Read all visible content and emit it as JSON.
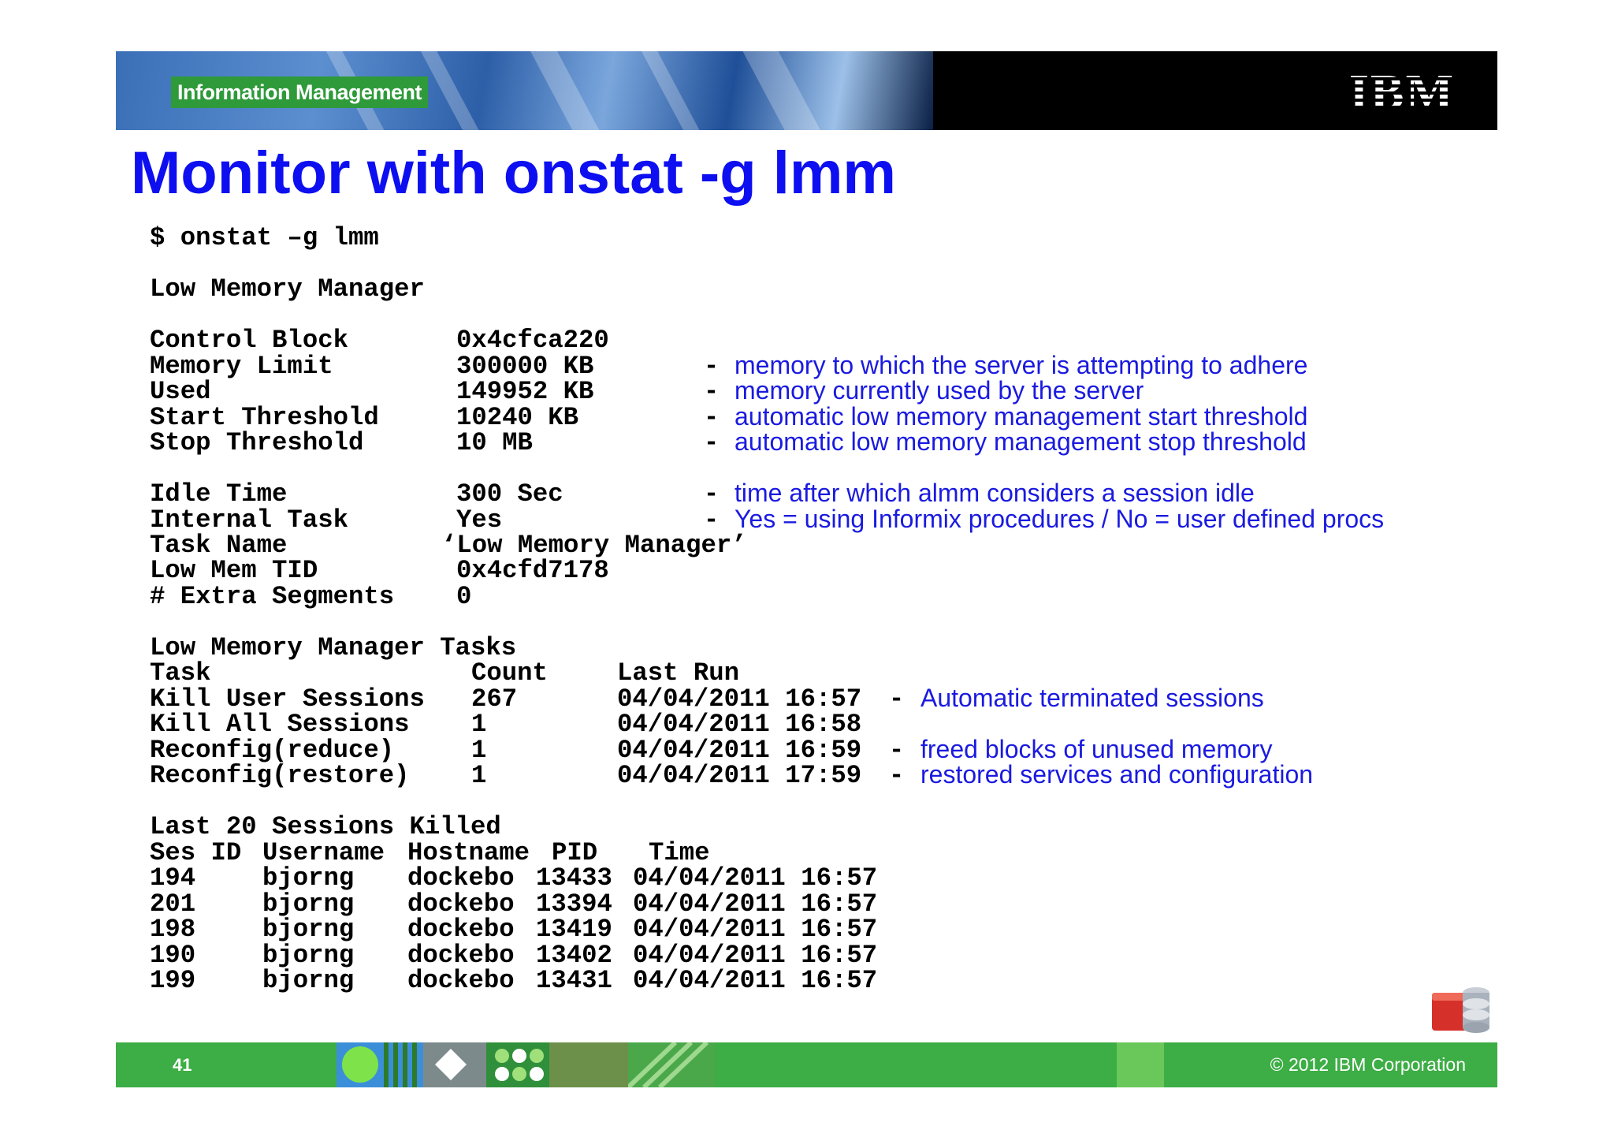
{
  "header": {
    "badge": "Information Management",
    "logo_text": "IBM"
  },
  "title": "Monitor with onstat -g lmm",
  "command": "$ onstat –g lmm",
  "section1_title": "Low Memory Manager",
  "params": [
    {
      "label": "Control Block",
      "value": "0x4cfca220",
      "note": ""
    },
    {
      "label": "Memory Limit",
      "value": "300000 KB",
      "note": "memory to which the server is attempting to adhere"
    },
    {
      "label": "Used",
      "value": "149952 KB",
      "note": "memory currently used by the server"
    },
    {
      "label": "Start Threshold",
      "value": "10240 KB",
      "note": "automatic low memory management start threshold"
    },
    {
      "label": "Stop Threshold",
      "value": "10 MB",
      "note": "automatic low memory management stop threshold"
    }
  ],
  "params2": [
    {
      "label": "Idle Time",
      "value": "300 Sec",
      "note": "time after which almm considers a session idle"
    },
    {
      "label": "Internal Task",
      "value": "Yes",
      "note": "Yes = using Informix procedures / No = user defined procs"
    },
    {
      "label": "Task Name",
      "value": "‘Low Memory Manager’",
      "note": ""
    },
    {
      "label": "Low Mem TID",
      "value": "0x4cfd7178",
      "note": ""
    },
    {
      "label": "# Extra Segments",
      "value": "0",
      "note": ""
    }
  ],
  "tasks": {
    "title": "Low Memory Manager Tasks",
    "headers": {
      "task": "Task",
      "count": "Count",
      "last_run": "Last Run"
    },
    "rows": [
      {
        "task": "Kill User Sessions",
        "count": "267",
        "last_run": "04/04/2011 16:57",
        "note": "Automatic terminated sessions"
      },
      {
        "task": "Kill All Sessions",
        "count": "1",
        "last_run": "04/04/2011 16:58",
        "note": ""
      },
      {
        "task": "Reconfig(reduce)",
        "count": "1",
        "last_run": "04/04/2011 16:59",
        "note": "freed blocks of unused memory"
      },
      {
        "task": "Reconfig(restore)",
        "count": "1",
        "last_run": "04/04/2011 17:59",
        "note": "restored services and configuration"
      }
    ]
  },
  "sessions": {
    "title": "Last 20 Sessions Killed",
    "headers": {
      "ses_id": "Ses ID",
      "username": "Username",
      "hostname": "Hostname",
      "pid": "PID",
      "time": "Time"
    },
    "rows": [
      {
        "ses_id": "194",
        "username": "bjorng",
        "hostname": "dockebo",
        "pid": "13433",
        "time": "04/04/2011 16:57"
      },
      {
        "ses_id": "201",
        "username": "bjorng",
        "hostname": "dockebo",
        "pid": "13394",
        "time": "04/04/2011 16:57"
      },
      {
        "ses_id": "198",
        "username": "bjorng",
        "hostname": "dockebo",
        "pid": "13419",
        "time": "04/04/2011 16:57"
      },
      {
        "ses_id": "190",
        "username": "bjorng",
        "hostname": "dockebo",
        "pid": "13402",
        "time": "04/04/2011 16:57"
      },
      {
        "ses_id": "199",
        "username": "bjorng",
        "hostname": "dockebo",
        "pid": "13431",
        "time": "04/04/2011 16:57"
      }
    ]
  },
  "footer": {
    "page_number": "41",
    "copyright": "© 2012 IBM Corporation"
  },
  "colors": {
    "title": "#0d0ff0",
    "note": "#1a1ae0",
    "footer": "#3dad45"
  },
  "icons": [
    "database-icon"
  ]
}
